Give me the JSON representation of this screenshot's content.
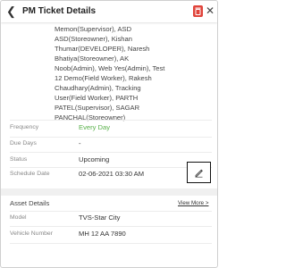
{
  "header": {
    "title": "PM Ticket Details"
  },
  "assignees": [
    "Memon(Supervisor), ASD",
    "ASD(Storeowner), Kishan",
    "Thumar(DEVELOPER), Naresh",
    "Bhatiya(Storeowner), AK",
    "Noob(Admin), Web Yes(Admin), Test",
    "12 Demo(Field Worker), Rakesh",
    "Chaudhary(Admin), Tracking",
    "User(Field Worker), PARTH",
    "PATEL(Supervisor), SAGAR",
    "PANCHAL(Storeowner)"
  ],
  "details": {
    "frequency_label": "Frequency",
    "frequency_value": "Every Day",
    "due_days_label": "Due Days",
    "due_days_value": "-",
    "status_label": "Status",
    "status_value": "Upcoming",
    "schedule_label": "Schedule Date",
    "schedule_value": "02-06-2021 03:30 AM"
  },
  "asset": {
    "section_title": "Asset Details",
    "view_more": "View More >",
    "model_label": "Model",
    "model_value": "TVS-Star City",
    "vehicle_label": "Vehicle Number",
    "vehicle_value": "MH 12 AA 7890"
  },
  "colors": {
    "accent_green": "#5ab14b",
    "delete_red": "#e0443b",
    "highlight_border": "#111111"
  },
  "icons": {
    "back": "back-arrow-icon",
    "delete": "trash-icon",
    "close": "close-icon",
    "edit": "pencil-icon"
  }
}
